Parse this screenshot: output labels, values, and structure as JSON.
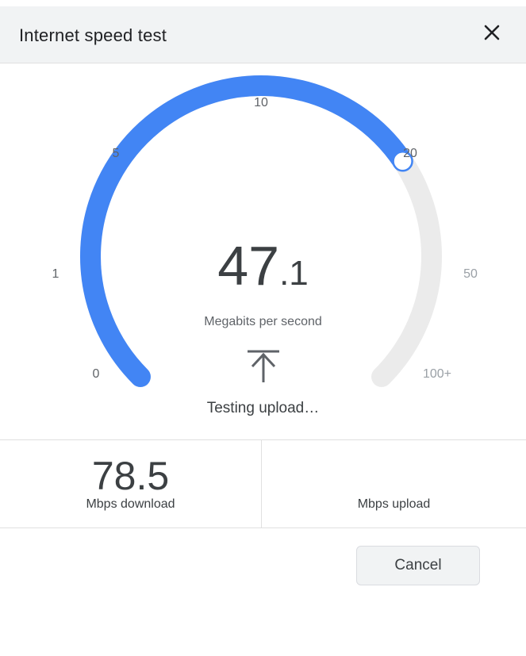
{
  "dialog": {
    "title": "Internet speed test",
    "close_icon": "close-icon"
  },
  "gauge": {
    "ticks": [
      "0",
      "1",
      "5",
      "10",
      "20",
      "50",
      "100+"
    ],
    "fill_fraction": 0.708,
    "active_color": "#4285f4",
    "track_color": "#ebebeb",
    "speed_integer": "47",
    "speed_decimal": ".1",
    "unit": "Megabits per second",
    "status_icon": "upload-arrow-icon",
    "status": "Testing upload…"
  },
  "results": {
    "download_value": "78.5",
    "download_label": "Mbps download",
    "upload_value": "",
    "upload_label": "Mbps upload"
  },
  "actions": {
    "cancel_label": "Cancel"
  }
}
